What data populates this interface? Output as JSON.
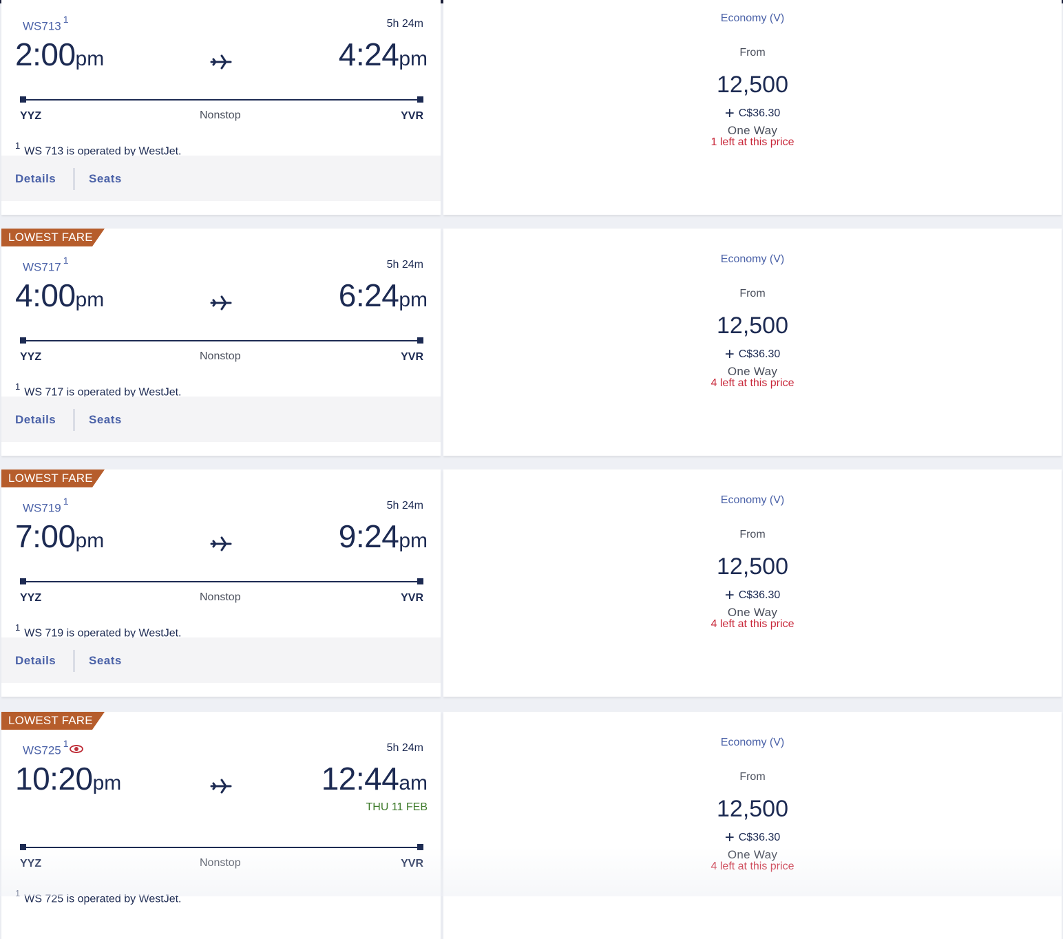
{
  "colors": {
    "navy": "#1c2a52",
    "link_blue": "#4b62a8",
    "badge_bg": "#b65d2c",
    "seats_red": "#c8283a",
    "next_day_green": "#3d7a2a"
  },
  "flights": [
    {
      "badge": "",
      "flight_no": "WS713",
      "footnote_mark": "1",
      "has_eye_icon": false,
      "duration": "5h 24m",
      "depart_time": "2:00",
      "depart_ampm": "pm",
      "arrive_time": "4:24",
      "arrive_ampm": "pm",
      "next_day": "",
      "origin": "YYZ",
      "destination": "YVR",
      "stops": "Nonstop",
      "operated_by": "WS 713 is operated by WestJet.",
      "details_label": "Details",
      "seats_label": "Seats",
      "fare_class": "Economy (V)",
      "from_label": "From",
      "miles": "12,500",
      "taxes": "C$36.30",
      "trip_type": "One Way",
      "seats_left": "1 left at this price"
    },
    {
      "badge": "LOWEST FARE",
      "flight_no": "WS717",
      "footnote_mark": "1",
      "has_eye_icon": false,
      "duration": "5h 24m",
      "depart_time": "4:00",
      "depart_ampm": "pm",
      "arrive_time": "6:24",
      "arrive_ampm": "pm",
      "next_day": "",
      "origin": "YYZ",
      "destination": "YVR",
      "stops": "Nonstop",
      "operated_by": "WS 717 is operated by WestJet.",
      "details_label": "Details",
      "seats_label": "Seats",
      "fare_class": "Economy (V)",
      "from_label": "From",
      "miles": "12,500",
      "taxes": "C$36.30",
      "trip_type": "One Way",
      "seats_left": "4 left at this price"
    },
    {
      "badge": "LOWEST FARE",
      "flight_no": "WS719",
      "footnote_mark": "1",
      "has_eye_icon": false,
      "duration": "5h 24m",
      "depart_time": "7:00",
      "depart_ampm": "pm",
      "arrive_time": "9:24",
      "arrive_ampm": "pm",
      "next_day": "",
      "origin": "YYZ",
      "destination": "YVR",
      "stops": "Nonstop",
      "operated_by": "WS 719 is operated by WestJet.",
      "details_label": "Details",
      "seats_label": "Seats",
      "fare_class": "Economy (V)",
      "from_label": "From",
      "miles": "12,500",
      "taxes": "C$36.30",
      "trip_type": "One Way",
      "seats_left": "4 left at this price"
    },
    {
      "badge": "LOWEST FARE",
      "flight_no": "WS725",
      "footnote_mark": "1",
      "has_eye_icon": true,
      "duration": "5h 24m",
      "depart_time": "10:20",
      "depart_ampm": "pm",
      "arrive_time": "12:44",
      "arrive_ampm": "am",
      "next_day": "THU 11 FEB",
      "origin": "YYZ",
      "destination": "YVR",
      "stops": "Nonstop",
      "operated_by": "WS 725 is operated by WestJet.",
      "details_label": "Details",
      "seats_label": "Seats",
      "fare_class": "Economy (V)",
      "from_label": "From",
      "miles": "12,500",
      "taxes": "C$36.30",
      "trip_type": "One Way",
      "seats_left": "4 left at this price"
    }
  ]
}
